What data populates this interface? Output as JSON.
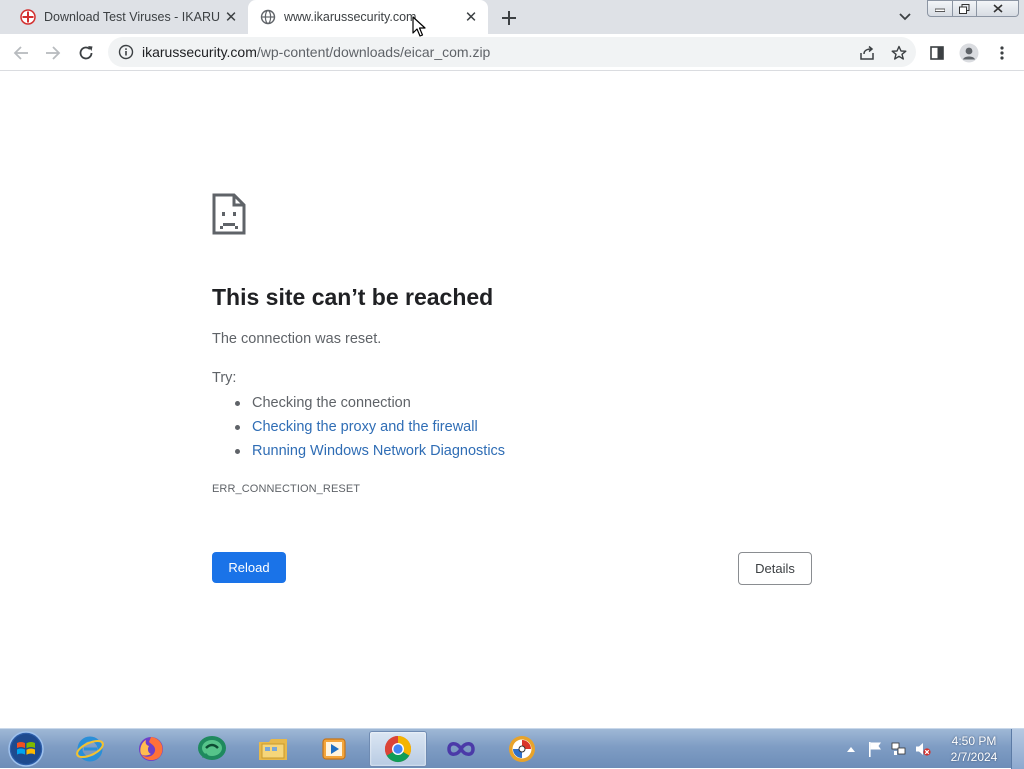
{
  "tabs": [
    {
      "title": "Download Test Viruses - IKARUS",
      "icon": "ikarus-favicon"
    },
    {
      "title": "www.ikarussecurity.com",
      "icon": "globe-icon",
      "active": true
    }
  ],
  "omnibox": {
    "host": "ikarussecurity.com",
    "path": "/wp-content/downloads/eicar_com.zip"
  },
  "error": {
    "title": "This site can’t be reached",
    "description": "The connection was reset.",
    "try_label": "Try:",
    "suggestions": [
      {
        "text": "Checking the connection",
        "link": false
      },
      {
        "text": "Checking the proxy and the firewall",
        "link": true
      },
      {
        "text": "Running Windows Network Diagnostics",
        "link": true
      }
    ],
    "code": "ERR_CONNECTION_RESET",
    "reload_label": "Reload",
    "details_label": "Details"
  },
  "taskbar": {
    "apps": [
      "internet-explorer-icon",
      "firefox-icon",
      "chat-app-icon",
      "file-explorer-icon",
      "media-player-icon",
      "chrome-icon",
      "visual-studio-icon",
      "ikarus-app-icon"
    ],
    "active_app": "chrome-icon",
    "clock_time": "4:50 PM",
    "clock_date": "2/7/2024"
  },
  "colors": {
    "accent": "#1a73e8",
    "link": "#2f6db5",
    "tabstrip": "#dee1e6"
  }
}
